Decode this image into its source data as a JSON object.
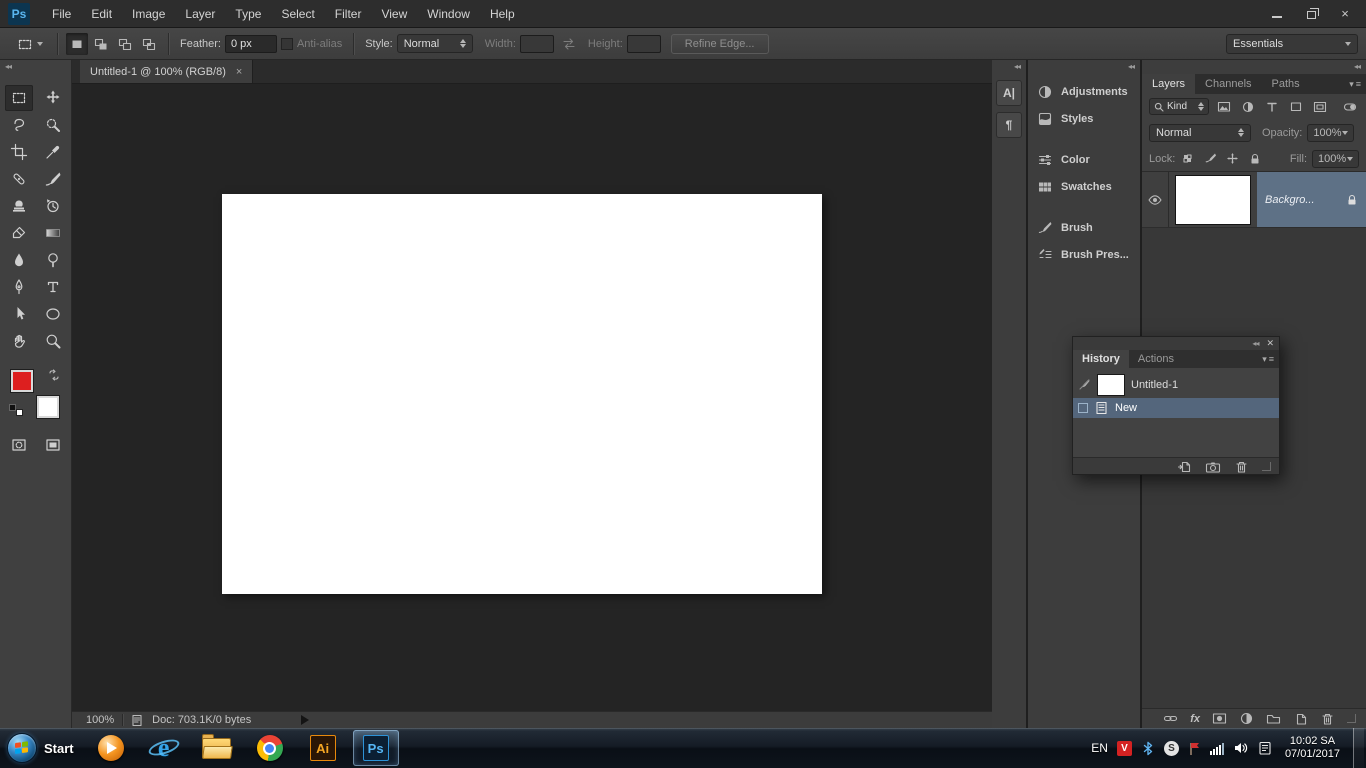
{
  "app": {
    "logo": "Ps",
    "menus": [
      "File",
      "Edit",
      "Image",
      "Layer",
      "Type",
      "Select",
      "Filter",
      "View",
      "Window",
      "Help"
    ],
    "window_controls": [
      "minimize",
      "restore",
      "close"
    ]
  },
  "options_bar": {
    "tool_preset_icon": "rectangular-marquee",
    "selection_modes": [
      "new-selection",
      "add-to-selection",
      "subtract-from-selection",
      "intersect-selection"
    ],
    "feather_label": "Feather:",
    "feather_value": "0 px",
    "antialias_label": "Anti-alias",
    "style_label": "Style:",
    "style_value": "Normal",
    "width_label": "Width:",
    "width_value": "",
    "height_label": "Height:",
    "height_value": "",
    "refine_edge_label": "Refine Edge...",
    "workspace": "Essentials"
  },
  "toolbar": {
    "tools": [
      "rectangular-marquee",
      "move",
      "lasso",
      "quick-selection",
      "crop",
      "eyedropper",
      "healing-brush",
      "brush",
      "clone-stamp",
      "history-brush",
      "eraser",
      "gradient",
      "blur",
      "dodge",
      "pen",
      "type",
      "path-selection",
      "shape",
      "hand",
      "zoom"
    ],
    "selected_tool": "rectangular-marquee",
    "foreground_color": "#dd1f1f",
    "background_color": "#ffffff",
    "extras": [
      "quick-mask",
      "screen-mode"
    ]
  },
  "document": {
    "tab_title": "Untitled-1 @ 100% (RGB/8)",
    "zoom_level": "100%",
    "doc_info": "Doc: 703.1K/0 bytes"
  },
  "right_rail": {
    "collapsed_panels": [
      {
        "name": "character-panel",
        "glyph": "A|"
      },
      {
        "name": "paragraph-panel",
        "glyph": "¶"
      }
    ],
    "icon_panels": [
      "Adjustments",
      "Styles",
      "Color",
      "Swatches",
      "Brush",
      "Brush Pres..."
    ]
  },
  "layers_panel": {
    "tabs": [
      "Layers",
      "Channels",
      "Paths"
    ],
    "filter_label": "Kind",
    "filter_icons": [
      "pixel-layers",
      "adjustment-layers",
      "type-layers",
      "shape-layers",
      "smart-objects"
    ],
    "blend_mode": "Normal",
    "opacity_label": "Opacity:",
    "opacity_value": "100%",
    "lock_label": "Lock:",
    "lock_icons": [
      "lock-transparency",
      "lock-pixels",
      "lock-position",
      "lock-all"
    ],
    "fill_label": "Fill:",
    "fill_value": "100%",
    "layer": {
      "name": "Backgro...",
      "locked": true,
      "visible": true
    },
    "selection_color": "#5e7186",
    "footer_icons": [
      "link-layers",
      "layer-style",
      "layer-mask",
      "adjustment-layer",
      "layer-group",
      "new-layer",
      "delete-layer"
    ]
  },
  "history_panel": {
    "tabs": [
      "History",
      "Actions"
    ],
    "doc_entry": "Untitled-1",
    "state_entry": "New",
    "footer_icons": [
      "new-document-from-state",
      "new-snapshot",
      "delete-state"
    ]
  },
  "taskbar": {
    "start_label": "Start",
    "apps": [
      "windows-media-player",
      "internet-explorer",
      "file-explorer",
      "chrome",
      "illustrator",
      "photoshop"
    ],
    "active_app": "photoshop",
    "ai_label": "Ai",
    "ps_label": "Ps",
    "tray": {
      "language": "EN",
      "icons": [
        "unikey",
        "bluetooth",
        "skype",
        "security-flag",
        "network",
        "volume",
        "devices"
      ],
      "unikey_glyph": "V",
      "skype_glyph": "S",
      "time": "10:02 SA",
      "date": "07/01/2017"
    }
  }
}
